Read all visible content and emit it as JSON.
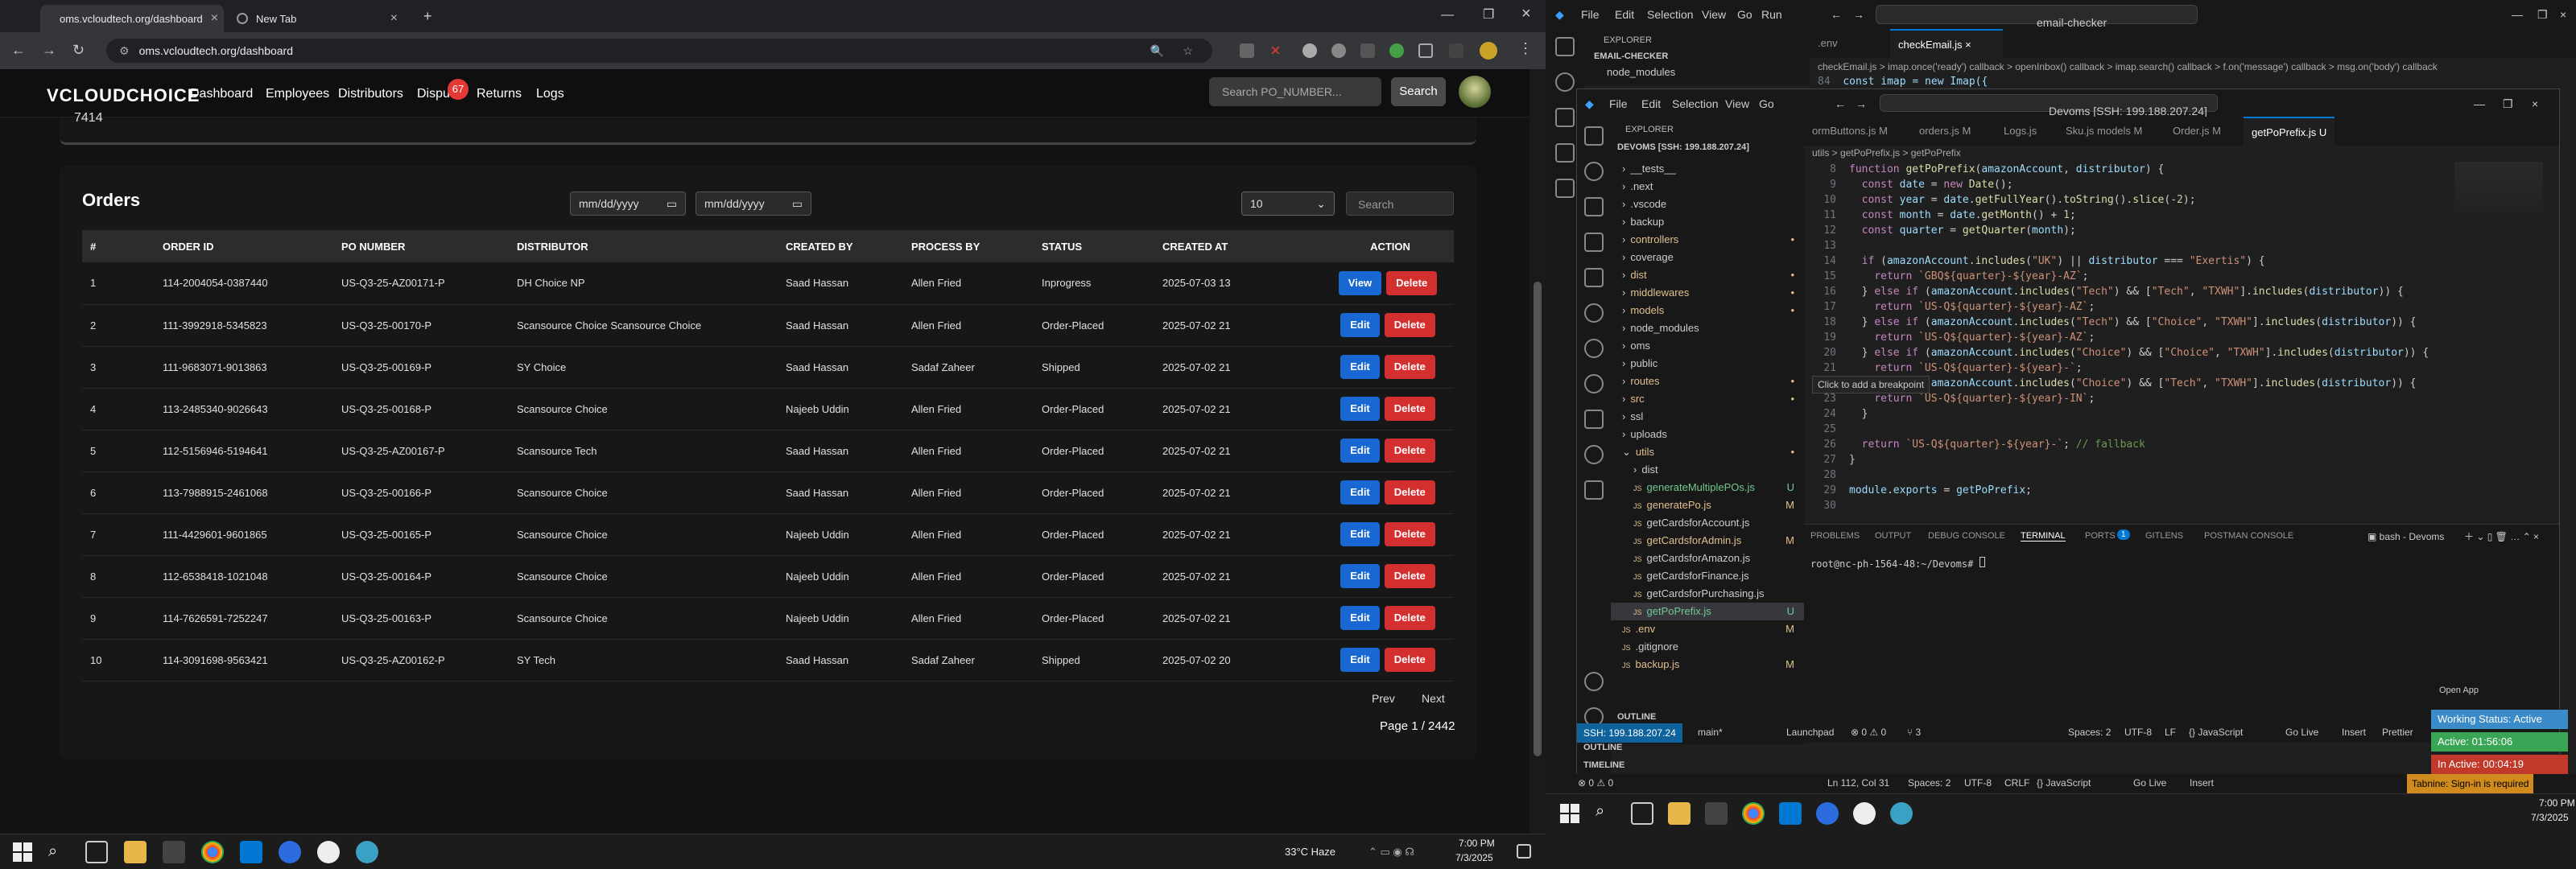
{
  "browser": {
    "tabs": [
      {
        "label": "oms.vcloudtech.org/dashboard"
      },
      {
        "label": "New Tab"
      }
    ],
    "url": "oms.vcloudtech.org/dashboard"
  },
  "app": {
    "logo": "VCLOUDCHOICE",
    "nav": [
      "Dashboard",
      "Employees",
      "Distributors",
      "Disputes",
      "Returns",
      "Logs"
    ],
    "disputes_badge": "67",
    "search_placeholder": "Search PO_NUMBER...",
    "search_button": "Search",
    "top_number": "7414"
  },
  "orders": {
    "title": "Orders",
    "date_from": "mm/dd/yyyy",
    "date_to": "mm/dd/yyyy",
    "page_size": "10",
    "filter_placeholder": "Search",
    "columns": [
      "#",
      "ORDER ID",
      "PO NUMBER",
      "DISTRIBUTOR",
      "CREATED BY",
      "PROCESS BY",
      "STATUS",
      "CREATED AT",
      "ACTION"
    ],
    "rows": [
      [
        "1",
        "114-2004054-0387440",
        "US-Q3-25-AZ00171-P",
        "DH Choice NP",
        "Saad Hassan",
        "Allen Fried",
        "Inprogress",
        "2025-07-03 13",
        "View"
      ],
      [
        "2",
        "111-3992918-5345823",
        "US-Q3-25-00170-P",
        "Scansource Choice Scansource Choice",
        "Saad Hassan",
        "Allen Fried",
        "Order-Placed",
        "2025-07-02 21",
        "Edit"
      ],
      [
        "3",
        "111-9683071-9013863",
        "US-Q3-25-00169-P",
        "SY Choice",
        "Saad Hassan",
        "Sadaf Zaheer",
        "Shipped",
        "2025-07-02 21",
        "Edit"
      ],
      [
        "4",
        "113-2485340-9026643",
        "US-Q3-25-00168-P",
        "Scansource Choice",
        "Najeeb Uddin",
        "Allen Fried",
        "Order-Placed",
        "2025-07-02 21",
        "Edit"
      ],
      [
        "5",
        "112-5156946-5194641",
        "US-Q3-25-AZ00167-P",
        "Scansource Tech",
        "Saad Hassan",
        "Allen Fried",
        "Order-Placed",
        "2025-07-02 21",
        "Edit"
      ],
      [
        "6",
        "113-7988915-2461068",
        "US-Q3-25-00166-P",
        "Scansource Choice",
        "Saad Hassan",
        "Allen Fried",
        "Order-Placed",
        "2025-07-02 21",
        "Edit"
      ],
      [
        "7",
        "111-4429601-9601865",
        "US-Q3-25-00165-P",
        "Scansource Choice",
        "Najeeb Uddin",
        "Allen Fried",
        "Order-Placed",
        "2025-07-02 21",
        "Edit"
      ],
      [
        "8",
        "112-6538418-1021048",
        "US-Q3-25-00164-P",
        "Scansource Choice",
        "Najeeb Uddin",
        "Allen Fried",
        "Order-Placed",
        "2025-07-02 21",
        "Edit"
      ],
      [
        "9",
        "114-7626591-7252247",
        "US-Q3-25-00163-P",
        "Scansource Choice",
        "Najeeb Uddin",
        "Allen Fried",
        "Order-Placed",
        "2025-07-02 21",
        "Edit"
      ],
      [
        "10",
        "114-3091698-9563421",
        "US-Q3-25-AZ00162-P",
        "SY Tech",
        "Saad Hassan",
        "Sadaf Zaheer",
        "Shipped",
        "2025-07-02 20",
        "Edit"
      ]
    ],
    "delete_label": "Delete",
    "prev": "Prev",
    "next": "Next",
    "page_info": "Page 1 / 2442"
  },
  "taskbar_left": {
    "weather": "33°C  Haze",
    "time": "7:00 PM",
    "date": "7/3/2025"
  },
  "vscode": {
    "menu": [
      "File",
      "Edit",
      "Selection",
      "View",
      "Go",
      "Run"
    ],
    "title_search": "email-checker",
    "remote_title": "Devoms [SSH: 199.188.207.24]",
    "back_tabs": [
      ".env",
      "checkEmail.js"
    ],
    "back_breadcrumb": "checkEmail.js > imap.once('ready') callback > openInbox() callback > imap.search() callback > f.on('message') callback > msg.on('body') callback",
    "back_line": "const imap = new Imap({",
    "back_line_no": "84",
    "back_explorer_title": "EXPLORER",
    "back_explorer_root": "EMAIL-CHECKER",
    "back_explorer_item": "node_modules",
    "explorer_title": "EXPLORER",
    "explorer_root": "DEVOMS [SSH: 199.188.207.24]",
    "tree": [
      {
        "n": "__tests__",
        "d": 1,
        "f": 1
      },
      {
        "n": ".next",
        "d": 1,
        "f": 1
      },
      {
        "n": ".vscode",
        "d": 1,
        "f": 1
      },
      {
        "n": "backup",
        "d": 1,
        "f": 1
      },
      {
        "n": "controllers",
        "d": 1,
        "f": 1,
        "c": "m"
      },
      {
        "n": "coverage",
        "d": 1,
        "f": 1
      },
      {
        "n": "dist",
        "d": 1,
        "f": 1,
        "c": "m"
      },
      {
        "n": "middlewares",
        "d": 1,
        "f": 1,
        "c": "m"
      },
      {
        "n": "models",
        "d": 1,
        "f": 1,
        "c": "m"
      },
      {
        "n": "node_modules",
        "d": 1,
        "f": 1
      },
      {
        "n": "oms",
        "d": 1,
        "f": 1
      },
      {
        "n": "public",
        "d": 1,
        "f": 1
      },
      {
        "n": "routes",
        "d": 1,
        "f": 1,
        "c": "m"
      },
      {
        "n": "src",
        "d": 1,
        "f": 1,
        "c": "m"
      },
      {
        "n": "ssl",
        "d": 1,
        "f": 1
      },
      {
        "n": "uploads",
        "d": 1,
        "f": 1
      },
      {
        "n": "utils",
        "d": 1,
        "f": 1,
        "o": 1,
        "c": "m"
      },
      {
        "n": "dist",
        "d": 2,
        "f": 1
      },
      {
        "n": "generateMultiplePOs.js",
        "d": 2,
        "c": "u"
      },
      {
        "n": "generatePo.js",
        "d": 2,
        "c": "m"
      },
      {
        "n": "getCardsforAccount.js",
        "d": 2
      },
      {
        "n": "getCardsforAdmin.js",
        "d": 2,
        "c": "m"
      },
      {
        "n": "getCardsforAmazon.js",
        "d": 2
      },
      {
        "n": "getCardsforFinance.js",
        "d": 2
      },
      {
        "n": "getCardsforPurchasing.js",
        "d": 2
      },
      {
        "n": "getPoPrefix.js",
        "d": 2,
        "c": "u",
        "s": 1
      },
      {
        "n": ".env",
        "d": 1,
        "c": "m"
      },
      {
        "n": ".gitignore",
        "d": 1
      },
      {
        "n": "backup.js",
        "d": 1,
        "c": "m"
      }
    ],
    "outline": "OUTLINE",
    "timeline": "TIMELINE",
    "editor_tabs": [
      "ormButtons.js M",
      "orders.js M",
      "Logs.js",
      "Sku.js models M",
      "Order.js M",
      "getPoPrefix.js U"
    ],
    "breadcrumb": "utils > getPoPrefix.js > getPoPrefix",
    "hover_tip": "Click to add a breakpoint",
    "panel_tabs": [
      "PROBLEMS",
      "OUTPUT",
      "DEBUG CONSOLE",
      "TERMINAL",
      "PORTS",
      "GITLENS",
      "POSTMAN CONSOLE"
    ],
    "ports_count": "1",
    "shell": "bash - Devoms",
    "terminal_line": "root@nc-ph-1564-48:~/Devoms# ",
    "status_inner": {
      "ssh": "SSH: 199.188.207.24",
      "branch": "main*",
      "launchpad": "Launchpad",
      "errs": "⊗ 0 ⚠ 0",
      "ports": "⑂ 3",
      "spaces": "Spaces: 2",
      "enc": "UTF-8",
      "eol": "LF",
      "lang": "{} JavaScript",
      "live": "Go Live",
      "insert": "Insert",
      "prettier": "Prettier"
    },
    "status_outer": {
      "pos": "Ln 112, Col 31",
      "spaces": "Spaces: 2",
      "enc": "UTF-8",
      "eol": "CRLF",
      "lang": "{} JavaScript",
      "live": "Go Live",
      "insert": "Insert",
      "tabnine": "Tabnine: Sign-in is required",
      "errs": "⊗ 0 ⚠ 0"
    },
    "work_status": {
      "open": "Open App",
      "working": "Working Status: Active",
      "active": "Active: 01:56:06",
      "inactive": "In Active: 00:04:19"
    },
    "tray": {
      "time": "7:00 PM",
      "date": "7/3/2025"
    }
  }
}
